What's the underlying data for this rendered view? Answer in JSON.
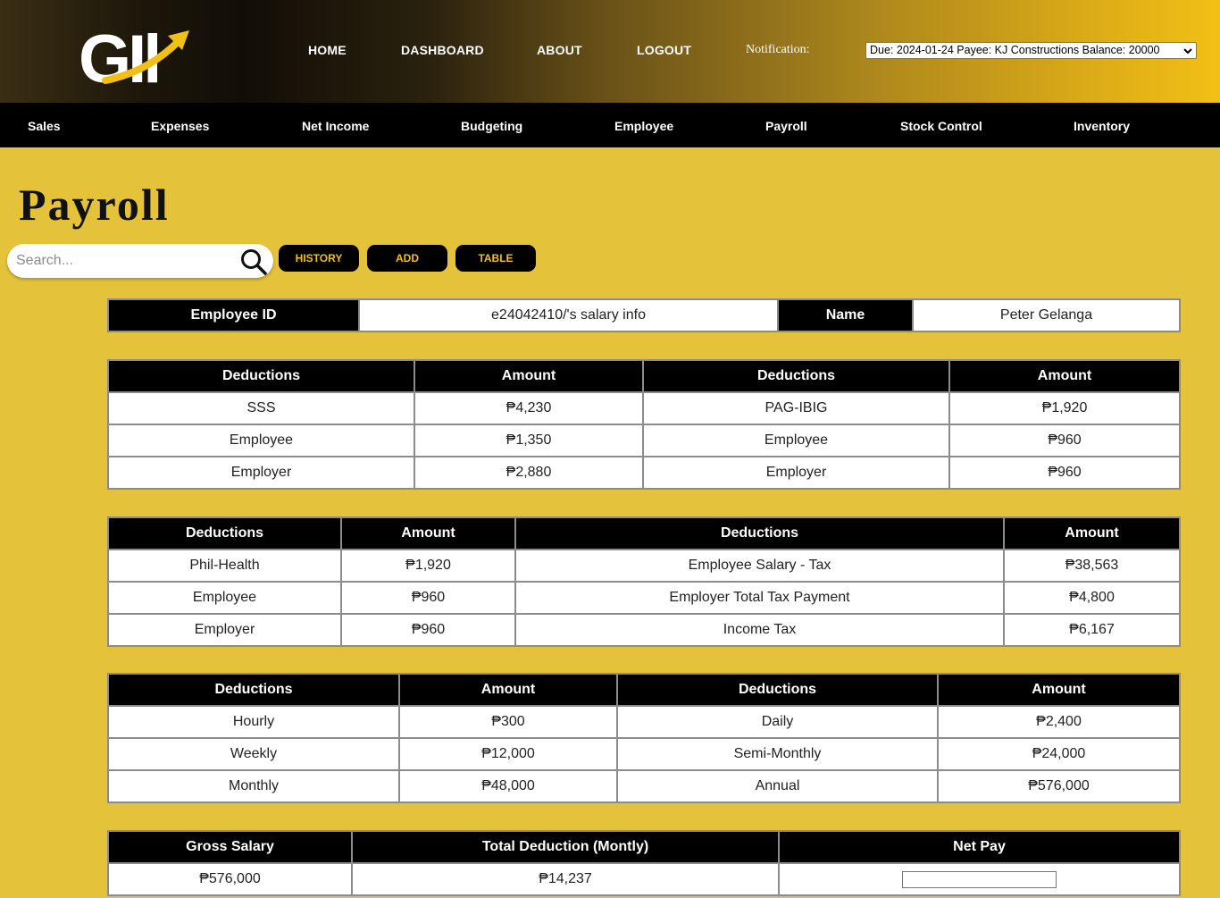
{
  "top_nav": {
    "home": "HOME",
    "dashboard": "DASHBOARD",
    "about": "ABOUT",
    "logout": "LOGOUT"
  },
  "notification": {
    "label": "Notification:",
    "selected": "Due: 2024-01-24 Payee: KJ Constructions Balance: 20000"
  },
  "sub_nav": {
    "sales": "Sales",
    "expenses": "Expenses",
    "net_income": "Net Income",
    "budgeting": "Budgeting",
    "employee": "Employee",
    "payroll": "Payroll",
    "stock_control": "Stock Control",
    "inventory": "Inventory"
  },
  "page": {
    "title": "Payroll"
  },
  "search": {
    "placeholder": "Search..."
  },
  "actions": {
    "history": "HISTORY",
    "add": "ADD",
    "table": "TABLE"
  },
  "employee_info": {
    "id_label": "Employee ID",
    "id_value": "e24042410/'s salary info",
    "name_label": "Name",
    "name_value": "Peter Gelanga"
  },
  "table1": {
    "headers": [
      "Deductions",
      "Amount",
      "Deductions",
      "Amount"
    ],
    "rows": [
      [
        "SSS",
        "₱4,230",
        "PAG-IBIG",
        "₱1,920"
      ],
      [
        "Employee",
        "₱1,350",
        "Employee",
        "₱960"
      ],
      [
        "Employer",
        "₱2,880",
        "Employer",
        "₱960"
      ]
    ]
  },
  "table2": {
    "headers": [
      "Deductions",
      "Amount",
      "Deductions",
      "Amount"
    ],
    "rows": [
      [
        "Phil-Health",
        "₱1,920",
        "Employee Salary - Tax",
        "₱38,563"
      ],
      [
        "Employee",
        "₱960",
        "Employer Total Tax Payment",
        "₱4,800"
      ],
      [
        "Employer",
        "₱960",
        "Income Tax",
        "₱6,167"
      ]
    ]
  },
  "table3": {
    "headers": [
      "Deductions",
      "Amount",
      "Deductions",
      "Amount"
    ],
    "rows": [
      [
        "Hourly",
        "₱300",
        "Daily",
        "₱2,400"
      ],
      [
        "Weekly",
        "₱12,000",
        "Semi-Monthly",
        "₱24,000"
      ],
      [
        "Monthly",
        "₱48,000",
        "Annual",
        "₱576,000"
      ]
    ]
  },
  "summary": {
    "headers": [
      "Gross Salary",
      "Total Deduction (Montly)",
      "Net Pay"
    ],
    "gross_salary": "₱576,000",
    "total_deduction": "₱14,237",
    "net_pay": ""
  }
}
